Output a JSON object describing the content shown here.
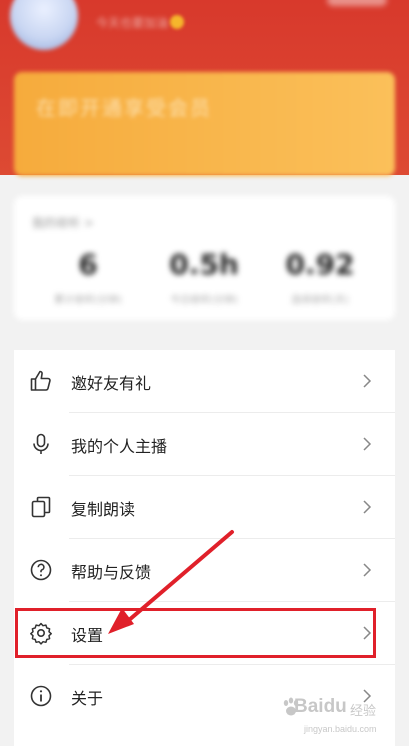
{
  "header": {
    "username": "今天也要加油",
    "promo_text": "在即开通享受会员"
  },
  "stats": {
    "title": "我的收听 >",
    "items": [
      {
        "value": "6",
        "label": "累计收听(分钟)"
      },
      {
        "value": "0.5h",
        "label": "今日收听(分钟)"
      },
      {
        "value": "0.92",
        "label": "连续收听(天)"
      }
    ]
  },
  "menu": {
    "items": [
      {
        "label": "邀好友有礼",
        "icon": "thumbs-up-icon"
      },
      {
        "label": "我的个人主播",
        "icon": "microphone-icon"
      },
      {
        "label": "复制朗读",
        "icon": "copy-icon"
      },
      {
        "label": "帮助与反馈",
        "icon": "help-icon"
      },
      {
        "label": "设置",
        "icon": "gear-icon"
      },
      {
        "label": "关于",
        "icon": "info-icon"
      }
    ]
  },
  "annotation": {
    "color": "#e0202a"
  },
  "watermark": {
    "logo": "Baidu",
    "suffix": "经验",
    "url": "jingyan.baidu.com"
  }
}
